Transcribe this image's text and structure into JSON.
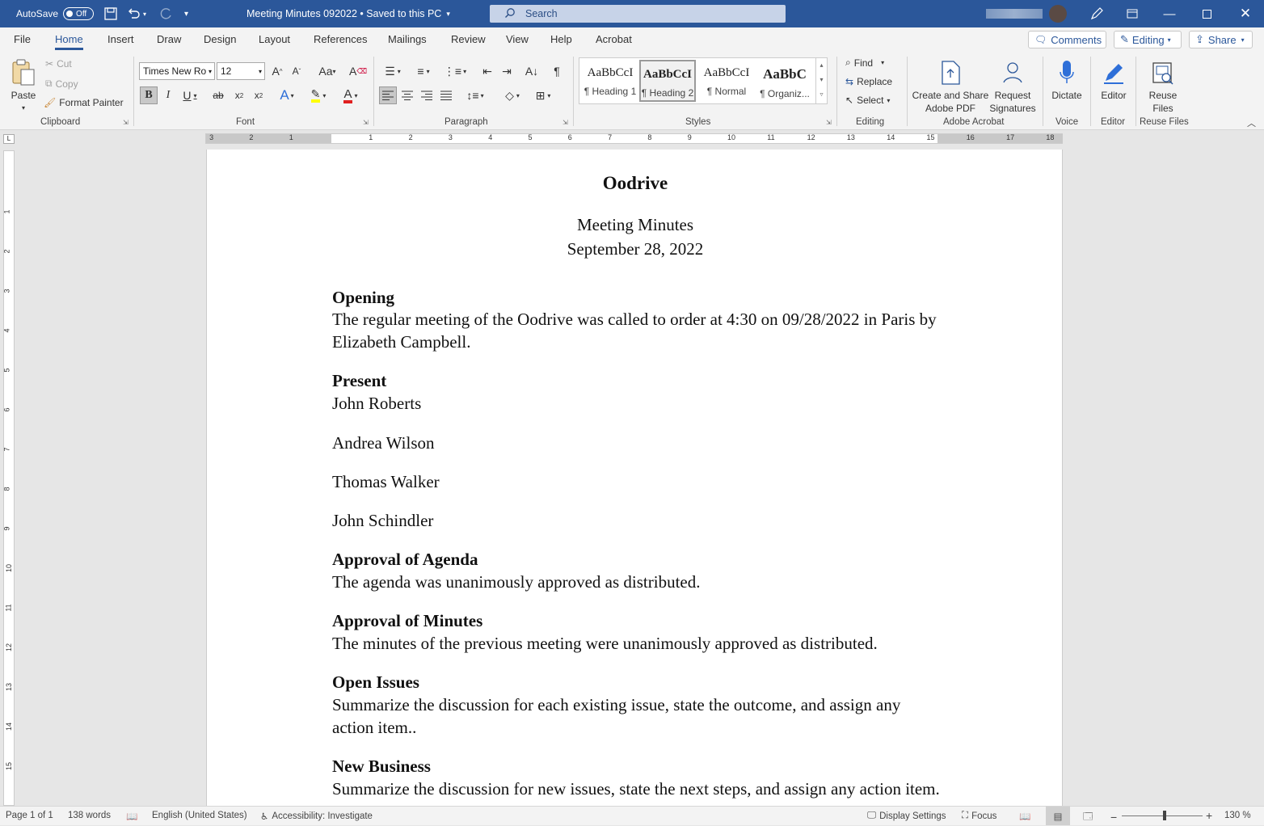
{
  "titlebar": {
    "autosave_label": "AutoSave",
    "autosave_state": "Off",
    "doc_title": "Meeting Minutes 092022 • Saved to this PC",
    "search_placeholder": "Search"
  },
  "tabs": [
    "File",
    "Home",
    "Insert",
    "Draw",
    "Design",
    "Layout",
    "References",
    "Mailings",
    "Review",
    "View",
    "Help",
    "Acrobat"
  ],
  "active_tab": "Home",
  "right_buttons": {
    "comments": "Comments",
    "editing": "Editing",
    "share": "Share"
  },
  "clipboard": {
    "paste": "Paste",
    "cut": "Cut",
    "copy": "Copy",
    "format_painter": "Format Painter",
    "label": "Clipboard"
  },
  "font": {
    "name": "Times New Ro",
    "size": "12",
    "label": "Font"
  },
  "paragraph": {
    "label": "Paragraph"
  },
  "styles": {
    "label": "Styles",
    "items": [
      {
        "sample": "AaBbCcI",
        "name": "¶ Heading 1"
      },
      {
        "sample": "AaBbCcI",
        "name": "¶ Heading 2"
      },
      {
        "sample": "AaBbCcI",
        "name": "¶ Normal"
      },
      {
        "sample": "AaBbC",
        "name": "¶ Organiz..."
      }
    ]
  },
  "editing": {
    "find": "Find",
    "replace": "Replace",
    "select": "Select",
    "label": "Editing"
  },
  "acrobat": {
    "create": "Create and Share",
    "create2": "Adobe PDF",
    "request": "Request",
    "request2": "Signatures",
    "label": "Adobe Acrobat"
  },
  "voice": {
    "dictate": "Dictate",
    "label": "Voice"
  },
  "editor": {
    "editor": "Editor",
    "label": "Editor"
  },
  "reuse": {
    "reuse": "Reuse",
    "reuse2": "Files",
    "label": "Reuse Files"
  },
  "ruler": {
    "h_labels": [
      "3",
      "2",
      "1",
      "1",
      "2",
      "3",
      "4",
      "5",
      "6",
      "7",
      "8",
      "9",
      "10",
      "11",
      "12",
      "13",
      "14",
      "15",
      "16",
      "17",
      "18"
    ],
    "v_labels": [
      "1",
      "2",
      "3",
      "4",
      "5",
      "6",
      "7",
      "8",
      "9",
      "10",
      "11",
      "12",
      "13",
      "14",
      "15"
    ]
  },
  "document": {
    "title": "Oodrive",
    "subtitle": "Meeting Minutes",
    "date": "September 28, 2022",
    "opening_h": "Opening",
    "opening_l1": "The regular meeting of the Oodrive was called to order at 4:30 on 09/28/2022 in Paris by",
    "opening_l2": "Elizabeth Campbell.",
    "present_h": "Present",
    "present": [
      "John Roberts",
      "Andrea Wilson",
      "Thomas Walker",
      "John Schindler"
    ],
    "agenda_h": "Approval of Agenda",
    "agenda_t": "The agenda was unanimously approved as distributed.",
    "minutes_h": "Approval of Minutes",
    "minutes_t": "The minutes of the previous meeting were unanimously approved as distributed.",
    "issues_h": "Open Issues",
    "issues_l1": "Summarize the discussion for each existing issue, state the outcome, and assign any",
    "issues_l2": "action item..",
    "newbiz_h": "New Business",
    "newbiz_t": "Summarize the discussion for new issues, state the next steps, and assign any action item."
  },
  "status": {
    "page": "Page 1 of 1",
    "words": "138 words",
    "language": "English (United States)",
    "accessibility": "Accessibility: Investigate",
    "display": "Display Settings",
    "focus": "Focus",
    "zoom": "130 %"
  }
}
